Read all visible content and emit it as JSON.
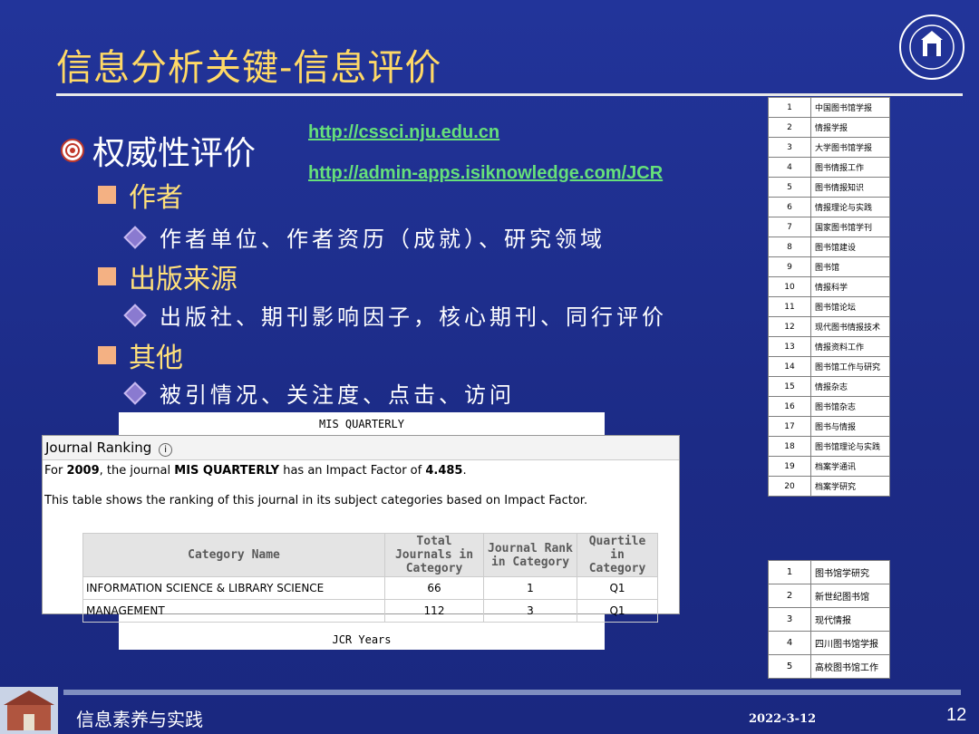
{
  "slide": {
    "title": "信息分析关键-信息评价",
    "heading": "权威性评价",
    "urls": [
      "http://cssci.nju.edu.cn",
      "http://admin-apps.isiknowledge.com/JCR"
    ],
    "sections": [
      {
        "label": "作者",
        "detail": "作者单位、作者资历（成就）、研究领域"
      },
      {
        "label": "出版来源",
        "detail": "出版社、期刊影响因子，核心期刊、同行评价"
      },
      {
        "label": "其他",
        "detail": "被引情况、关注度、点击、访问"
      }
    ],
    "footer_text": "信息素养与实践",
    "date": "2022-3-12",
    "page_number": "12"
  },
  "journal_list_1": [
    {
      "n": "1",
      "name": "中国图书馆学报"
    },
    {
      "n": "2",
      "name": "情报学报"
    },
    {
      "n": "3",
      "name": "大学图书馆学报"
    },
    {
      "n": "4",
      "name": "图书情报工作"
    },
    {
      "n": "5",
      "name": "图书情报知识"
    },
    {
      "n": "6",
      "name": "情报理论与实践"
    },
    {
      "n": "7",
      "name": "国家图书馆学刊"
    },
    {
      "n": "8",
      "name": "图书馆建设"
    },
    {
      "n": "9",
      "name": "图书馆"
    },
    {
      "n": "10",
      "name": "情报科学"
    },
    {
      "n": "11",
      "name": "图书馆论坛"
    },
    {
      "n": "12",
      "name": "现代图书情报技术"
    },
    {
      "n": "13",
      "name": "情报资料工作"
    },
    {
      "n": "14",
      "name": "图书馆工作与研究"
    },
    {
      "n": "15",
      "name": "情报杂志"
    },
    {
      "n": "16",
      "name": "图书馆杂志"
    },
    {
      "n": "17",
      "name": "图书与情报"
    },
    {
      "n": "18",
      "name": "图书馆理论与实践"
    },
    {
      "n": "19",
      "name": "档案学通讯"
    },
    {
      "n": "20",
      "name": "档案学研究"
    }
  ],
  "journal_list_2": [
    {
      "n": "1",
      "name": "图书馆学研究"
    },
    {
      "n": "2",
      "name": "新世纪图书馆"
    },
    {
      "n": "3",
      "name": "现代情报"
    },
    {
      "n": "4",
      "name": "四川图书馆学报"
    },
    {
      "n": "5",
      "name": "高校图书馆工作"
    }
  ],
  "jcr_chart": {
    "title": "MIS QUARTERLY",
    "xlabel": "JCR Years"
  },
  "journal_ranking": {
    "header": "Journal Ranking",
    "info_icon": "i",
    "sentence_prefix": "For",
    "year": "2009",
    "sentence_mid1": ", the journal",
    "journal": "MIS QUARTERLY",
    "sentence_mid2": "has an Impact Factor of",
    "impact_factor": "4.485",
    "sentence_end": ".",
    "description": "This table shows the ranking of this journal in its subject categories based on Impact Factor.",
    "columns": [
      "Category Name",
      "Total Journals in Category",
      "Journal Rank in Category",
      "Quartile in Category"
    ],
    "rows": [
      [
        "INFORMATION SCIENCE & LIBRARY SCIENCE",
        "66",
        "1",
        "Q1"
      ],
      [
        "MANAGEMENT",
        "112",
        "3",
        "Q1"
      ]
    ]
  },
  "colors": {
    "background": "#1f2f8c",
    "title": "#ffd966",
    "url": "#66e07a",
    "level1": "#ffe07a",
    "bullet_square": "#f4b183"
  }
}
